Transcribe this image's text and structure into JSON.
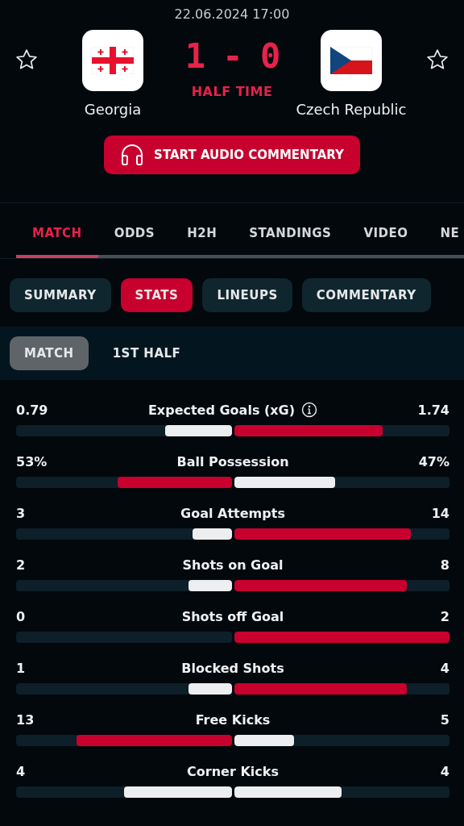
{
  "match": {
    "datetime": "22.06.2024 17:00",
    "score": "1 - 0",
    "status": "HALF TIME",
    "home": {
      "name": "Georgia",
      "favorite": false
    },
    "away": {
      "name": "Czech Republic",
      "favorite": false
    },
    "audio_button": "START AUDIO COMMENTARY"
  },
  "tabs": [
    {
      "label": "MATCH",
      "selected": true
    },
    {
      "label": "ODDS",
      "selected": false
    },
    {
      "label": "H2H",
      "selected": false
    },
    {
      "label": "STANDINGS",
      "selected": false
    },
    {
      "label": "VIDEO",
      "selected": false
    },
    {
      "label": "NE",
      "selected": false
    }
  ],
  "chips": [
    {
      "label": "SUMMARY",
      "selected": false
    },
    {
      "label": "STATS",
      "selected": true
    },
    {
      "label": "LINEUPS",
      "selected": false
    },
    {
      "label": "COMMENTARY",
      "selected": false
    }
  ],
  "periods": [
    {
      "label": "MATCH",
      "selected": true
    },
    {
      "label": "1ST HALF",
      "selected": false
    }
  ],
  "stats": [
    {
      "name": "Expected Goals (xG)",
      "info": true,
      "home": "0.79",
      "away": "1.74",
      "home_bar": {
        "level": 0.31
      },
      "away_bar": {
        "level": 0.69
      }
    },
    {
      "name": "Ball Possession",
      "info": false,
      "home": "53%",
      "away": "47%",
      "home_bar": {
        "level": 0.53
      },
      "away_bar": {
        "level": 0.47
      }
    },
    {
      "name": "Goal Attempts",
      "info": false,
      "home": "3",
      "away": "14",
      "home_bar": {
        "level": 0.18
      },
      "away_bar": {
        "level": 0.82
      }
    },
    {
      "name": "Shots on Goal",
      "info": false,
      "home": "2",
      "away": "8",
      "home_bar": {
        "level": 0.2
      },
      "away_bar": {
        "level": 0.8
      }
    },
    {
      "name": "Shots off Goal",
      "info": false,
      "home": "0",
      "away": "2",
      "home_bar": {
        "level": 0
      },
      "away_bar": {
        "level": 1
      }
    },
    {
      "name": "Blocked Shots",
      "info": false,
      "home": "1",
      "away": "4",
      "home_bar": {
        "level": 0.2
      },
      "away_bar": {
        "level": 0.8
      }
    },
    {
      "name": "Free Kicks",
      "info": false,
      "home": "13",
      "away": "5",
      "home_bar": {
        "level": 0.72
      },
      "away_bar": {
        "level": 0.28
      }
    },
    {
      "name": "Corner Kicks",
      "info": false,
      "home": "4",
      "away": "4",
      "home_bar": {
        "level": 0.5
      },
      "away_bar": {
        "level": 0.5
      }
    }
  ]
}
